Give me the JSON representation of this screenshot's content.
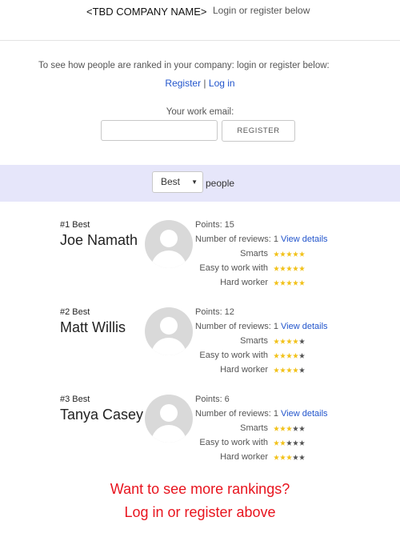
{
  "header": {
    "company_name": "<TBD COMPANY NAME>",
    "login_text": "Login or register below"
  },
  "register": {
    "message": "To see how people are ranked in your company: login or register below:",
    "register_link": "Register",
    "separator": " | ",
    "login_link": "Log in",
    "email_label": "Your work email:",
    "email_value": "",
    "register_button": "REGISTER"
  },
  "filter": {
    "selected": "Best",
    "suffix": "people"
  },
  "entries": [
    {
      "rank": "#1 Best",
      "name": "Joe Namath",
      "points_label": "Points: 15",
      "reviews_label": "Number of reviews:",
      "reviews_count": "1",
      "details_link": "View details",
      "traits": [
        {
          "label": "Smarts",
          "rating": 5
        },
        {
          "label": "Easy to work with",
          "rating": 5
        },
        {
          "label": "Hard worker",
          "rating": 5
        }
      ]
    },
    {
      "rank": "#2 Best",
      "name": "Matt Willis",
      "points_label": "Points: 12",
      "reviews_label": "Number of reviews:",
      "reviews_count": "1",
      "details_link": "View details",
      "traits": [
        {
          "label": "Smarts",
          "rating": 4
        },
        {
          "label": "Easy to work with",
          "rating": 4
        },
        {
          "label": "Hard worker",
          "rating": 4
        }
      ]
    },
    {
      "rank": "#3 Best",
      "name": "Tanya Casey",
      "points_label": "Points: 6",
      "reviews_label": "Number of reviews:",
      "reviews_count": "1",
      "details_link": "View details",
      "traits": [
        {
          "label": "Smarts",
          "rating": 3
        },
        {
          "label": "Easy to work with",
          "rating": 2
        },
        {
          "label": "Hard worker",
          "rating": 3
        }
      ]
    }
  ],
  "cta": {
    "line1": "Want to see more rankings?",
    "line2": "Log in or register above"
  },
  "colors": {
    "link": "#2255cc",
    "filter_band": "#e6e6fa",
    "cta": "#e8141e",
    "star_filled": "#f2c21b",
    "star_empty": "#555555"
  },
  "icons": {
    "avatar": "default-avatar-icon",
    "star": "star-icon",
    "caret": "chevron-down-icon"
  }
}
